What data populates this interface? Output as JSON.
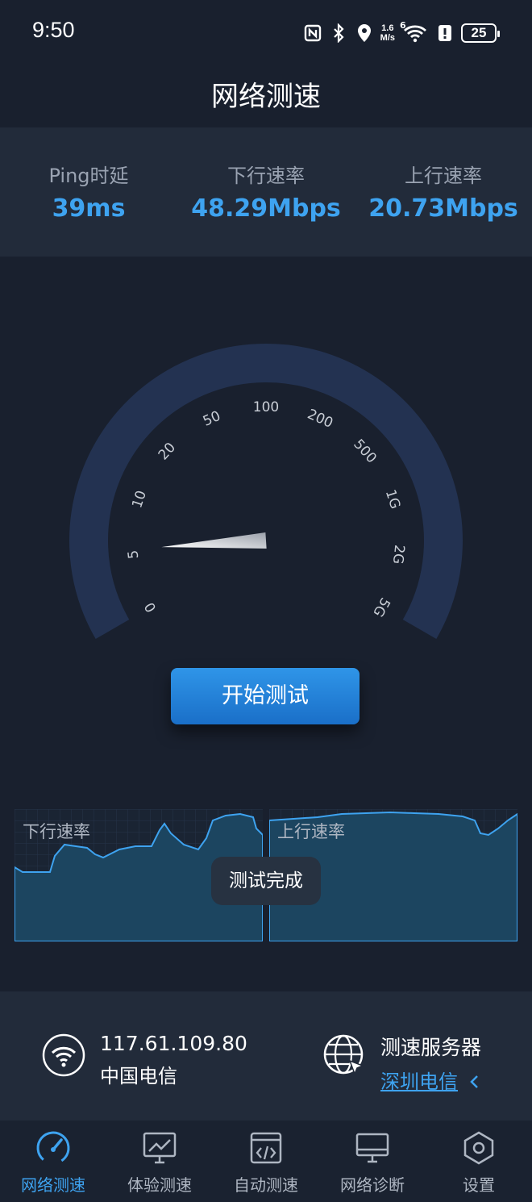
{
  "status": {
    "time": "9:50",
    "net_speed_value": "1.6",
    "net_speed_unit": "M/s",
    "wifi_gen": "6",
    "battery": "25"
  },
  "title": "网络测速",
  "stats": {
    "ping": {
      "label": "Ping时延",
      "value": "39ms"
    },
    "download": {
      "label": "下行速率",
      "value": "48.29Mbps"
    },
    "upload": {
      "label": "上行速率",
      "value": "20.73Mbps"
    }
  },
  "gauge": {
    "ticks": [
      "0",
      "5",
      "10",
      "20",
      "50",
      "100",
      "200",
      "500",
      "1G",
      "2G",
      "5G"
    ],
    "needle_value_fraction": 0.11
  },
  "start_button": "开始测试",
  "charts": {
    "download_title": "下行速率",
    "upload_title": "上行速率",
    "toast": "测试完成"
  },
  "info": {
    "ip": "117.61.109.80",
    "isp": "中国电信",
    "server_label": "测速服务器",
    "server_value": "深圳电信"
  },
  "nav": [
    {
      "label": "网络测速",
      "active": true
    },
    {
      "label": "体验测速",
      "active": false
    },
    {
      "label": "自动测速",
      "active": false
    },
    {
      "label": "网络诊断",
      "active": false
    },
    {
      "label": "设置",
      "active": false
    }
  ],
  "colors": {
    "accent": "#3ea3f0",
    "background": "#19202e",
    "panel": "#222b3a"
  }
}
